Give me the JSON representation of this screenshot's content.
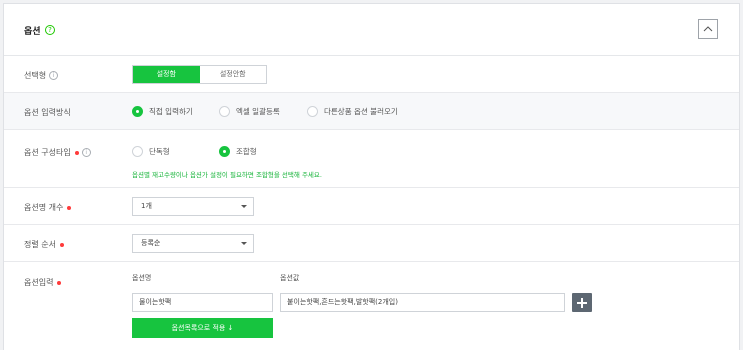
{
  "section": {
    "title": "옵션",
    "help_icon": "help-circle-icon",
    "collapse_icon": "chevron-up-icon"
  },
  "rows": {
    "selection": {
      "label": "선택형",
      "toggle": {
        "options": [
          "설정함",
          "설정안함"
        ],
        "selected": "설정함"
      }
    },
    "input_method": {
      "label": "옵션 입력방식",
      "options": [
        "직접 입력하기",
        "엑셀 일괄등록",
        "다른상품 옵션 불러오기"
      ],
      "selected": "직접 입력하기"
    },
    "composition_type": {
      "label": "옵션 구성타입",
      "options": [
        "단독형",
        "조합형"
      ],
      "selected": "조합형",
      "hint": "옵션별 재고수량이나 옵션가 설정이 필요하면 조합형을 선택해 주세요."
    },
    "option_name_count": {
      "label": "옵션명 개수",
      "value": "1개"
    },
    "sort_order": {
      "label": "정렬 순서",
      "value": "등록순"
    },
    "option_input": {
      "label": "옵션입력",
      "name_header": "옵션명",
      "value_header": "옵션값",
      "name_value": "물이는핫팩",
      "values_value": "붙이는핫팩,흔드는핫팩,발핫팩(2개입)",
      "apply_label": "옵션목록으로 적용 ↓"
    }
  },
  "colors": {
    "accent": "#17c43f",
    "required": "#ff3b3b",
    "plus_button": "#5d6772"
  }
}
